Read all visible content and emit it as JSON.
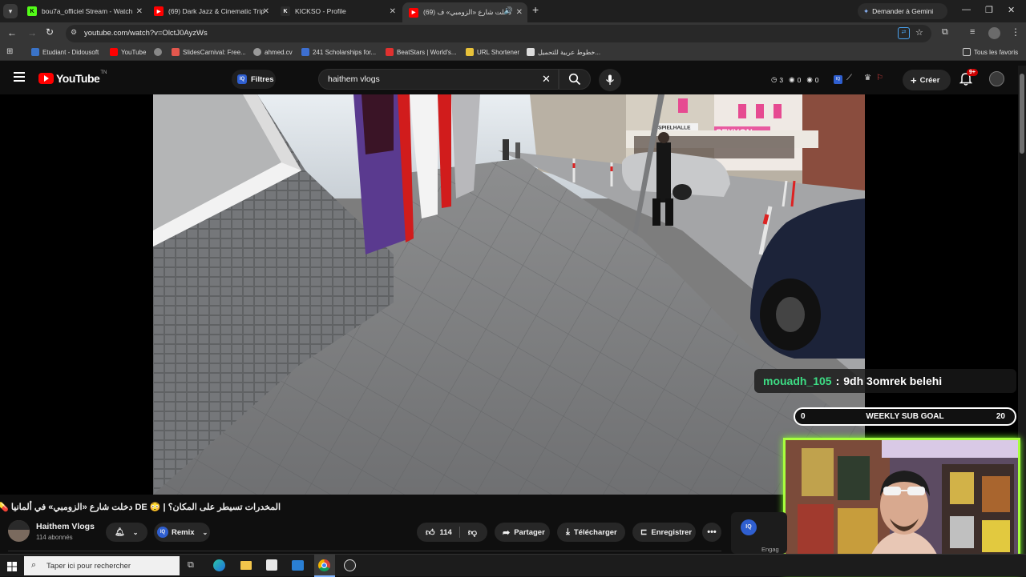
{
  "browser": {
    "tabs": [
      {
        "label": "bou7a_officiel Stream - Watch",
        "favicon_color": "#53fc18",
        "favicon_letter": "K"
      },
      {
        "label": "(69) Dark Jazz & Cinematic Trip",
        "favicon_color": "#ff0000",
        "favicon_letter": "▶"
      },
      {
        "label": "KICKSO - Profile",
        "favicon_color": "#2b2b2b",
        "favicon_letter": "K"
      },
      {
        "label": "(69) دخلت شارع «الزومبي» ف",
        "favicon_color": "#ff0000",
        "favicon_letter": "▶"
      }
    ],
    "new_tab": "+",
    "gemini_label": "Demander à Gemini",
    "url": "youtube.com/watch?v=OlctJ0AyzWs",
    "bookmarks": [
      {
        "label": "Etudiant - Didousoft",
        "color": "#3a73c8"
      },
      {
        "label": "YouTube",
        "color": "#ff0000"
      },
      {
        "label": "",
        "color": "#888888"
      },
      {
        "label": "SlidesCarnival: Free...",
        "color": "#e3574d"
      },
      {
        "label": "ahmed.cv",
        "color": "#9a9a9a"
      },
      {
        "label": "241 Scholarships for...",
        "color": "#3d6fd1"
      },
      {
        "label": "BeatStars | World's...",
        "color": "#e0312f"
      },
      {
        "label": "URL Shortener",
        "color": "#e8c23a"
      },
      {
        "label": "خطوط عربية للتحميل...",
        "color": "#dddddd"
      }
    ],
    "all_bookmarks": "Tous les favoris"
  },
  "youtube": {
    "logo": "YouTube",
    "logo_country": "TN",
    "filters_label": "Filtres",
    "search_value": "haithem vlogs",
    "header_counts": [
      "3",
      "0",
      "0"
    ],
    "create_label": "Créer",
    "notifications_badge": "9+",
    "video_title": "المخدرات تسيطر على المكان؟ | 😳 DE دخلت شارع «الزومبي» في ألمانيا 💊",
    "channel_name": "Haithem Vlogs",
    "subscribers": "114 abonnés",
    "remix_label": "Remix",
    "likes": "114",
    "share_label": "Partager",
    "download_label": "Télécharger",
    "save_label": "Enregistrer",
    "engage_label": "Engag"
  },
  "stream_overlay": {
    "chat_user": "mouadh_105",
    "chat_sep": ":",
    "chat_message": "9dh 3omrek belehi",
    "goal_current": "0",
    "goal_label": "WEEKLY SUB GOAL",
    "goal_target": "20",
    "goal_progress": 0
  },
  "video_scene": {
    "signs": [
      "SPIELHALLE",
      "SEXYON"
    ]
  },
  "taskbar": {
    "search_placeholder": "Taper ici pour rechercher"
  }
}
